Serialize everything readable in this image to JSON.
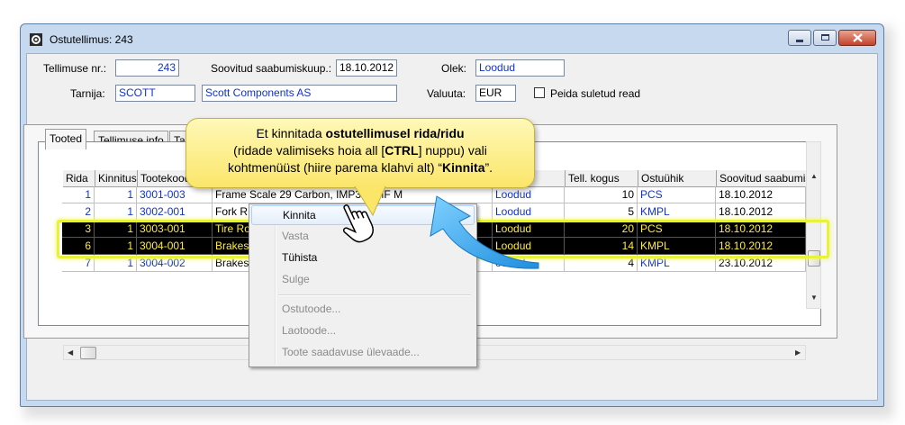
{
  "window": {
    "title": "Ostutellimus: 243"
  },
  "form": {
    "order_no_label": "Tellimuse nr.:",
    "order_no": "243",
    "expected_arrival_label": "Soovitud saabumiskuup.:",
    "expected_arrival": "18.10.2012",
    "status_label": "Olek:",
    "status": "Loodud",
    "supplier_label": "Tarnija:",
    "supplier_code": "SCOTT",
    "supplier_name": "Scott Components AS",
    "currency_label": "Valuuta:",
    "currency": "EUR",
    "hide_closed_label": "Peida suletud read"
  },
  "tabs": [
    {
      "label": "Tooted",
      "active": true
    },
    {
      "label": "Tellimuse info",
      "active": false
    },
    {
      "label": "Tarn",
      "active": false
    }
  ],
  "grid": {
    "columns": [
      "Rida",
      "Kinnitus",
      "Tootekood",
      "",
      "",
      "Tell. kogus",
      "Ostuühik",
      "Soovitud saabumiskuu"
    ],
    "rows": [
      {
        "rida": "1",
        "kinnitus": "1",
        "code": "3001-003",
        "name": "Frame Scale 29 Carbon, IMP3, HMF M",
        "name_tail": "Scale",
        "status": "Loodud",
        "qty": "10",
        "unit": "PCS",
        "date": "18.10.2012",
        "selected": false
      },
      {
        "rida": "2",
        "kinnitus": "1",
        "code": "3002-001",
        "name": "Fork R",
        "name_tail": "",
        "status": "Loodud",
        "qty": "5",
        "unit": "KMPL",
        "date": "18.10.2012",
        "selected": false
      },
      {
        "rida": "3",
        "kinnitus": "1",
        "code": "3003-001",
        "name": "Tire Ro",
        "name_tail": "",
        "status": "Loodud",
        "qty": "20",
        "unit": "PCS",
        "date": "18.10.2012",
        "selected": true
      },
      {
        "rida": "6",
        "kinnitus": "1",
        "code": "3004-001",
        "name": "Brakes",
        "name_tail": "",
        "status": "Loodud",
        "qty": "14",
        "unit": "KMPL",
        "date": "18.10.2012",
        "selected": true
      },
      {
        "rida": "7",
        "kinnitus": "1",
        "code": "3004-002",
        "name": "Brakes",
        "name_tail": "",
        "status": "oodud",
        "qty": "4",
        "unit": "KMPL",
        "date": "23.10.2012",
        "selected": false
      }
    ]
  },
  "context_menu": {
    "items": [
      {
        "label": "Kinnita",
        "enabled": true,
        "hover": true
      },
      {
        "label": "Vasta",
        "enabled": false
      },
      {
        "label": "Tühista",
        "enabled": true
      },
      {
        "label": "Sulge",
        "enabled": false
      },
      {
        "label": "Ostutoode...",
        "enabled": false
      },
      {
        "label": "Laotoode...",
        "enabled": false
      },
      {
        "label": "Toote saadavuse ülevaade...",
        "enabled": false
      }
    ]
  },
  "callout": {
    "line1_a": "Et kinnitada ",
    "line1_b": "ostutellimusel rida/ridu",
    "line2_a": "(ridade valimiseks hoia all [",
    "line2_b": "CTRL",
    "line2_c": "] nuppu) vali",
    "line3_a": "kohtmenüüst (hiire parema klahvi alt) “",
    "line3_b": "Kinnita",
    "line3_c": "”."
  },
  "colors": {
    "accent_text": "#1133cc",
    "selection_bg": "#000000",
    "selection_text": "#ffeb3b",
    "highlight_border": "#e8f23a",
    "callout_bg": "#fbe66a",
    "arrow": "#3aa3e6"
  }
}
